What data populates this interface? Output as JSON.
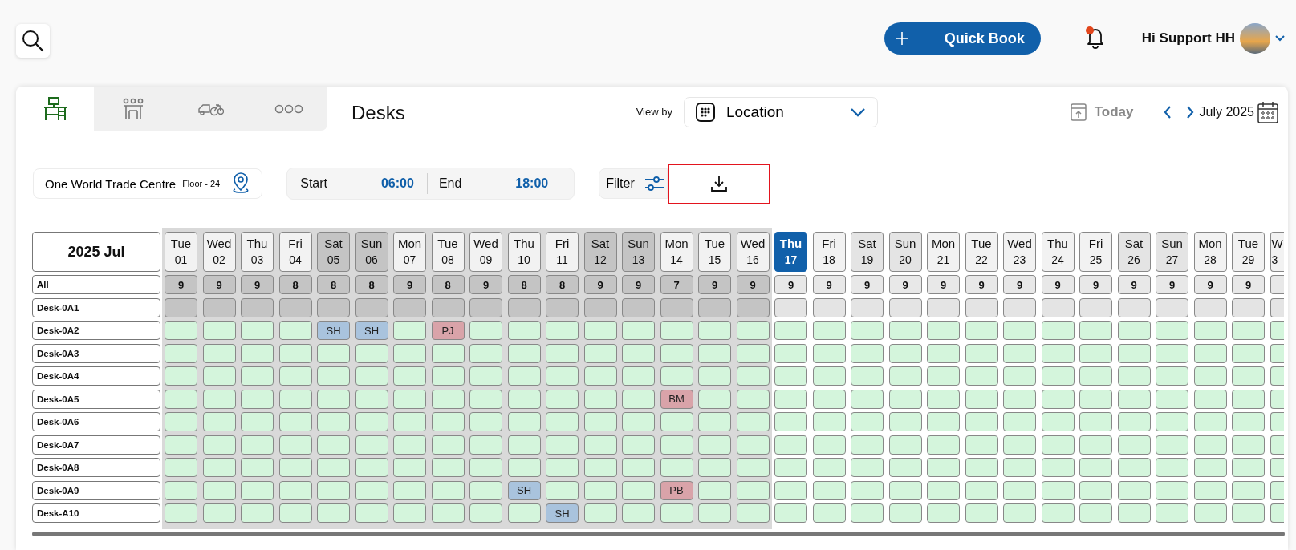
{
  "header": {
    "quick_book": "Quick Book",
    "notification": true,
    "greeting": "Hi Support HH"
  },
  "tabs": [
    {
      "kind": "desk",
      "selected": true
    },
    {
      "kind": "meeting",
      "selected": false
    },
    {
      "kind": "parking",
      "selected": false
    },
    {
      "kind": "more",
      "selected": false
    }
  ],
  "title": "Desks",
  "view_by": {
    "label": "View by",
    "value": "Location"
  },
  "navigation": {
    "today": "Today",
    "month": "July 2025"
  },
  "location": {
    "name": "One World Trade Centre",
    "floor": "Floor - 24"
  },
  "time": {
    "start_label": "Start",
    "start": "06:00",
    "end_label": "End",
    "end": "18:00"
  },
  "filter": {
    "label": "Filter"
  },
  "grid": {
    "corner": "2025 Jul",
    "all_label": "All",
    "days": [
      {
        "day": "Tue",
        "date": "01",
        "count": "9",
        "weekend": false,
        "past": true,
        "selected": false
      },
      {
        "day": "Wed",
        "date": "02",
        "count": "9",
        "weekend": false,
        "past": true,
        "selected": false
      },
      {
        "day": "Thu",
        "date": "03",
        "count": "9",
        "weekend": false,
        "past": true,
        "selected": false
      },
      {
        "day": "Fri",
        "date": "04",
        "count": "8",
        "weekend": false,
        "past": true,
        "selected": false
      },
      {
        "day": "Sat",
        "date": "05",
        "count": "8",
        "weekend": true,
        "past": true,
        "selected": false
      },
      {
        "day": "Sun",
        "date": "06",
        "count": "8",
        "weekend": true,
        "past": true,
        "selected": false
      },
      {
        "day": "Mon",
        "date": "07",
        "count": "9",
        "weekend": false,
        "past": true,
        "selected": false
      },
      {
        "day": "Tue",
        "date": "08",
        "count": "8",
        "weekend": false,
        "past": true,
        "selected": false
      },
      {
        "day": "Wed",
        "date": "09",
        "count": "9",
        "weekend": false,
        "past": true,
        "selected": false
      },
      {
        "day": "Thu",
        "date": "10",
        "count": "8",
        "weekend": false,
        "past": true,
        "selected": false
      },
      {
        "day": "Fri",
        "date": "11",
        "count": "8",
        "weekend": false,
        "past": true,
        "selected": false
      },
      {
        "day": "Sat",
        "date": "12",
        "count": "9",
        "weekend": true,
        "past": true,
        "selected": false
      },
      {
        "day": "Sun",
        "date": "13",
        "count": "9",
        "weekend": true,
        "past": true,
        "selected": false
      },
      {
        "day": "Mon",
        "date": "14",
        "count": "7",
        "weekend": false,
        "past": true,
        "selected": false
      },
      {
        "day": "Tue",
        "date": "15",
        "count": "9",
        "weekend": false,
        "past": true,
        "selected": false
      },
      {
        "day": "Wed",
        "date": "16",
        "count": "9",
        "weekend": false,
        "past": true,
        "selected": false
      },
      {
        "day": "Thu",
        "date": "17",
        "count": "9",
        "weekend": false,
        "past": false,
        "selected": true
      },
      {
        "day": "Fri",
        "date": "18",
        "count": "9",
        "weekend": false,
        "past": false,
        "selected": false
      },
      {
        "day": "Sat",
        "date": "19",
        "count": "9",
        "weekend": true,
        "past": false,
        "selected": false
      },
      {
        "day": "Sun",
        "date": "20",
        "count": "9",
        "weekend": true,
        "past": false,
        "selected": false
      },
      {
        "day": "Mon",
        "date": "21",
        "count": "9",
        "weekend": false,
        "past": false,
        "selected": false
      },
      {
        "day": "Tue",
        "date": "22",
        "count": "9",
        "weekend": false,
        "past": false,
        "selected": false
      },
      {
        "day": "Wed",
        "date": "23",
        "count": "9",
        "weekend": false,
        "past": false,
        "selected": false
      },
      {
        "day": "Thu",
        "date": "24",
        "count": "9",
        "weekend": false,
        "past": false,
        "selected": false
      },
      {
        "day": "Fri",
        "date": "25",
        "count": "9",
        "weekend": false,
        "past": false,
        "selected": false
      },
      {
        "day": "Sat",
        "date": "26",
        "count": "9",
        "weekend": true,
        "past": false,
        "selected": false
      },
      {
        "day": "Sun",
        "date": "27",
        "count": "9",
        "weekend": true,
        "past": false,
        "selected": false
      },
      {
        "day": "Mon",
        "date": "28",
        "count": "9",
        "weekend": false,
        "past": false,
        "selected": false
      },
      {
        "day": "Tue",
        "date": "29",
        "count": "9",
        "weekend": false,
        "past": false,
        "selected": false
      },
      {
        "day": "W",
        "date": "3",
        "weekend": false,
        "past": false,
        "selected": false
      }
    ],
    "rows": [
      {
        "name": "Desk-0A1",
        "cells": [
          {
            "kind": "blocked"
          },
          {
            "kind": "blocked"
          },
          {
            "kind": "blocked"
          },
          {
            "kind": "blocked"
          },
          {
            "kind": "blocked"
          },
          {
            "kind": "blocked"
          },
          {
            "kind": "blocked"
          },
          {
            "kind": "blocked"
          },
          {
            "kind": "blocked"
          },
          {
            "kind": "blocked"
          },
          {
            "kind": "blocked"
          },
          {
            "kind": "blocked"
          },
          {
            "kind": "blocked"
          },
          {
            "kind": "blocked"
          },
          {
            "kind": "blocked"
          },
          {
            "kind": "blocked"
          },
          {
            "kind": "blocked"
          },
          {
            "kind": "blocked"
          },
          {
            "kind": "blocked"
          },
          {
            "kind": "blocked"
          },
          {
            "kind": "blocked"
          },
          {
            "kind": "blocked"
          },
          {
            "kind": "blocked"
          },
          {
            "kind": "blocked"
          },
          {
            "kind": "blocked"
          },
          {
            "kind": "blocked"
          },
          {
            "kind": "blocked"
          },
          {
            "kind": "blocked"
          },
          {
            "kind": "blocked"
          },
          {
            "kind": "blocked"
          }
        ]
      },
      {
        "name": "Desk-0A2",
        "cells": [
          {
            "kind": "free"
          },
          {
            "kind": "free"
          },
          {
            "kind": "free"
          },
          {
            "kind": "free"
          },
          {
            "kind": "booked",
            "initials": "SH",
            "color": "#a9c3dd"
          },
          {
            "kind": "booked",
            "initials": "SH",
            "color": "#a9c3dd"
          },
          {
            "kind": "free"
          },
          {
            "kind": "booked",
            "initials": "PJ",
            "color": "#d9a3a9"
          },
          {
            "kind": "free"
          },
          {
            "kind": "free"
          },
          {
            "kind": "free"
          },
          {
            "kind": "free"
          },
          {
            "kind": "free"
          },
          {
            "kind": "free"
          },
          {
            "kind": "free"
          },
          {
            "kind": "free"
          },
          {
            "kind": "free"
          },
          {
            "kind": "free"
          },
          {
            "kind": "free"
          },
          {
            "kind": "free"
          },
          {
            "kind": "free"
          },
          {
            "kind": "free"
          },
          {
            "kind": "free"
          },
          {
            "kind": "free"
          },
          {
            "kind": "free"
          },
          {
            "kind": "free"
          },
          {
            "kind": "free"
          },
          {
            "kind": "free"
          },
          {
            "kind": "free"
          },
          {
            "kind": "free"
          }
        ]
      },
      {
        "name": "Desk-0A3",
        "cells": [
          {
            "kind": "free"
          },
          {
            "kind": "free"
          },
          {
            "kind": "free"
          },
          {
            "kind": "free"
          },
          {
            "kind": "free"
          },
          {
            "kind": "free"
          },
          {
            "kind": "free"
          },
          {
            "kind": "free"
          },
          {
            "kind": "free"
          },
          {
            "kind": "free"
          },
          {
            "kind": "free"
          },
          {
            "kind": "free"
          },
          {
            "kind": "free"
          },
          {
            "kind": "free"
          },
          {
            "kind": "free"
          },
          {
            "kind": "free"
          },
          {
            "kind": "free"
          },
          {
            "kind": "free"
          },
          {
            "kind": "free"
          },
          {
            "kind": "free"
          },
          {
            "kind": "free"
          },
          {
            "kind": "free"
          },
          {
            "kind": "free"
          },
          {
            "kind": "free"
          },
          {
            "kind": "free"
          },
          {
            "kind": "free"
          },
          {
            "kind": "free"
          },
          {
            "kind": "free"
          },
          {
            "kind": "free"
          },
          {
            "kind": "free"
          }
        ]
      },
      {
        "name": "Desk-0A4",
        "cells": [
          {
            "kind": "free"
          },
          {
            "kind": "free"
          },
          {
            "kind": "free"
          },
          {
            "kind": "free"
          },
          {
            "kind": "free"
          },
          {
            "kind": "free"
          },
          {
            "kind": "free"
          },
          {
            "kind": "free"
          },
          {
            "kind": "free"
          },
          {
            "kind": "free"
          },
          {
            "kind": "free"
          },
          {
            "kind": "free"
          },
          {
            "kind": "free"
          },
          {
            "kind": "free"
          },
          {
            "kind": "free"
          },
          {
            "kind": "free"
          },
          {
            "kind": "free"
          },
          {
            "kind": "free"
          },
          {
            "kind": "free"
          },
          {
            "kind": "free"
          },
          {
            "kind": "free"
          },
          {
            "kind": "free"
          },
          {
            "kind": "free"
          },
          {
            "kind": "free"
          },
          {
            "kind": "free"
          },
          {
            "kind": "free"
          },
          {
            "kind": "free"
          },
          {
            "kind": "free"
          },
          {
            "kind": "free"
          },
          {
            "kind": "free"
          }
        ]
      },
      {
        "name": "Desk-0A5",
        "cells": [
          {
            "kind": "free"
          },
          {
            "kind": "free"
          },
          {
            "kind": "free"
          },
          {
            "kind": "free"
          },
          {
            "kind": "free"
          },
          {
            "kind": "free"
          },
          {
            "kind": "free"
          },
          {
            "kind": "free"
          },
          {
            "kind": "free"
          },
          {
            "kind": "free"
          },
          {
            "kind": "free"
          },
          {
            "kind": "free"
          },
          {
            "kind": "free"
          },
          {
            "kind": "booked",
            "initials": "BM",
            "color": "#d9a3a9"
          },
          {
            "kind": "free"
          },
          {
            "kind": "free"
          },
          {
            "kind": "free"
          },
          {
            "kind": "free"
          },
          {
            "kind": "free"
          },
          {
            "kind": "free"
          },
          {
            "kind": "free"
          },
          {
            "kind": "free"
          },
          {
            "kind": "free"
          },
          {
            "kind": "free"
          },
          {
            "kind": "free"
          },
          {
            "kind": "free"
          },
          {
            "kind": "free"
          },
          {
            "kind": "free"
          },
          {
            "kind": "free"
          },
          {
            "kind": "free"
          }
        ]
      },
      {
        "name": "Desk-0A6",
        "cells": [
          {
            "kind": "free"
          },
          {
            "kind": "free"
          },
          {
            "kind": "free"
          },
          {
            "kind": "free"
          },
          {
            "kind": "free"
          },
          {
            "kind": "free"
          },
          {
            "kind": "free"
          },
          {
            "kind": "free"
          },
          {
            "kind": "free"
          },
          {
            "kind": "free"
          },
          {
            "kind": "free"
          },
          {
            "kind": "free"
          },
          {
            "kind": "free"
          },
          {
            "kind": "free"
          },
          {
            "kind": "free"
          },
          {
            "kind": "free"
          },
          {
            "kind": "free"
          },
          {
            "kind": "free"
          },
          {
            "kind": "free"
          },
          {
            "kind": "free"
          },
          {
            "kind": "free"
          },
          {
            "kind": "free"
          },
          {
            "kind": "free"
          },
          {
            "kind": "free"
          },
          {
            "kind": "free"
          },
          {
            "kind": "free"
          },
          {
            "kind": "free"
          },
          {
            "kind": "free"
          },
          {
            "kind": "free"
          },
          {
            "kind": "free"
          }
        ]
      },
      {
        "name": "Desk-0A7",
        "cells": [
          {
            "kind": "free"
          },
          {
            "kind": "free"
          },
          {
            "kind": "free"
          },
          {
            "kind": "free"
          },
          {
            "kind": "free"
          },
          {
            "kind": "free"
          },
          {
            "kind": "free"
          },
          {
            "kind": "free"
          },
          {
            "kind": "free"
          },
          {
            "kind": "free"
          },
          {
            "kind": "free"
          },
          {
            "kind": "free"
          },
          {
            "kind": "free"
          },
          {
            "kind": "free"
          },
          {
            "kind": "free"
          },
          {
            "kind": "free"
          },
          {
            "kind": "free"
          },
          {
            "kind": "free"
          },
          {
            "kind": "free"
          },
          {
            "kind": "free"
          },
          {
            "kind": "free"
          },
          {
            "kind": "free"
          },
          {
            "kind": "free"
          },
          {
            "kind": "free"
          },
          {
            "kind": "free"
          },
          {
            "kind": "free"
          },
          {
            "kind": "free"
          },
          {
            "kind": "free"
          },
          {
            "kind": "free"
          },
          {
            "kind": "free"
          }
        ]
      },
      {
        "name": "Desk-0A8",
        "cells": [
          {
            "kind": "free"
          },
          {
            "kind": "free"
          },
          {
            "kind": "free"
          },
          {
            "kind": "free"
          },
          {
            "kind": "free"
          },
          {
            "kind": "free"
          },
          {
            "kind": "free"
          },
          {
            "kind": "free"
          },
          {
            "kind": "free"
          },
          {
            "kind": "free"
          },
          {
            "kind": "free"
          },
          {
            "kind": "free"
          },
          {
            "kind": "free"
          },
          {
            "kind": "free"
          },
          {
            "kind": "free"
          },
          {
            "kind": "free"
          },
          {
            "kind": "free"
          },
          {
            "kind": "free"
          },
          {
            "kind": "free"
          },
          {
            "kind": "free"
          },
          {
            "kind": "free"
          },
          {
            "kind": "free"
          },
          {
            "kind": "free"
          },
          {
            "kind": "free"
          },
          {
            "kind": "free"
          },
          {
            "kind": "free"
          },
          {
            "kind": "free"
          },
          {
            "kind": "free"
          },
          {
            "kind": "free"
          },
          {
            "kind": "free"
          }
        ]
      },
      {
        "name": "Desk-0A9",
        "cells": [
          {
            "kind": "free"
          },
          {
            "kind": "free"
          },
          {
            "kind": "free"
          },
          {
            "kind": "free"
          },
          {
            "kind": "free"
          },
          {
            "kind": "free"
          },
          {
            "kind": "free"
          },
          {
            "kind": "free"
          },
          {
            "kind": "free"
          },
          {
            "kind": "booked",
            "initials": "SH",
            "color": "#a9c3dd"
          },
          {
            "kind": "free"
          },
          {
            "kind": "free"
          },
          {
            "kind": "free"
          },
          {
            "kind": "booked",
            "initials": "PB",
            "color": "#d9a3a9"
          },
          {
            "kind": "free"
          },
          {
            "kind": "free"
          },
          {
            "kind": "free"
          },
          {
            "kind": "free"
          },
          {
            "kind": "free"
          },
          {
            "kind": "free"
          },
          {
            "kind": "free"
          },
          {
            "kind": "free"
          },
          {
            "kind": "free"
          },
          {
            "kind": "free"
          },
          {
            "kind": "free"
          },
          {
            "kind": "free"
          },
          {
            "kind": "free"
          },
          {
            "kind": "free"
          },
          {
            "kind": "free"
          },
          {
            "kind": "free"
          }
        ]
      },
      {
        "name": "Desk-A10",
        "cells": [
          {
            "kind": "free"
          },
          {
            "kind": "free"
          },
          {
            "kind": "free"
          },
          {
            "kind": "free"
          },
          {
            "kind": "free"
          },
          {
            "kind": "free"
          },
          {
            "kind": "free"
          },
          {
            "kind": "free"
          },
          {
            "kind": "free"
          },
          {
            "kind": "free"
          },
          {
            "kind": "booked",
            "initials": "SH",
            "color": "#a9c3dd"
          },
          {
            "kind": "free"
          },
          {
            "kind": "free"
          },
          {
            "kind": "free"
          },
          {
            "kind": "free"
          },
          {
            "kind": "free"
          },
          {
            "kind": "free"
          },
          {
            "kind": "free"
          },
          {
            "kind": "free"
          },
          {
            "kind": "free"
          },
          {
            "kind": "free"
          },
          {
            "kind": "free"
          },
          {
            "kind": "free"
          },
          {
            "kind": "free"
          },
          {
            "kind": "free"
          },
          {
            "kind": "free"
          },
          {
            "kind": "free"
          },
          {
            "kind": "free"
          },
          {
            "kind": "free"
          },
          {
            "kind": "free"
          }
        ]
      }
    ]
  }
}
